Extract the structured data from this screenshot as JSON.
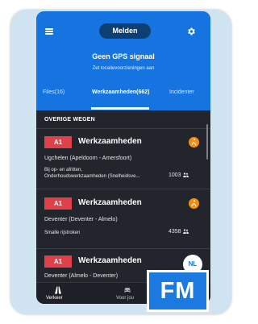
{
  "header": {
    "report_button": "Melden",
    "gps_title": "Geen GPS signaal",
    "gps_subtitle": "Zet locatievoorzieningen aan"
  },
  "tabs": [
    {
      "label": "Files(16)"
    },
    {
      "label": "Werkzaamheden(662)",
      "active": true
    },
    {
      "label": "Incidenter"
    }
  ],
  "section": {
    "title": "OVERIGE WEGEN"
  },
  "items": [
    {
      "road": "A1",
      "type": "Werkzaamheden",
      "route": "Ugchelen (Apeldoorn - Amersfoort)",
      "detail_line1": "Bij op- en afritten,",
      "detail_line2": "Onderhoudswerkzaamheden (Snelheidsve...",
      "count": "1003"
    },
    {
      "road": "A1",
      "type": "Werkzaamheden",
      "route": "Deventer (Deventer - Almelo)",
      "detail_line1": "Smalle rijstroken",
      "count": "4358"
    },
    {
      "road": "A1",
      "type": "Werkzaamheden",
      "route": "Deventer (Almelo - Deventer)"
    }
  ],
  "nl_badge": "NL",
  "bottom_nav": [
    {
      "label": "Verkeer",
      "icon": "road-icon"
    },
    {
      "label": "Voor jou",
      "icon": "car-icon"
    }
  ],
  "logo": "FM",
  "colors": {
    "header_blue": "#1574e0",
    "badge_red": "#e0404a",
    "cone_orange": "#f28c16",
    "background_dark": "#23252c"
  }
}
